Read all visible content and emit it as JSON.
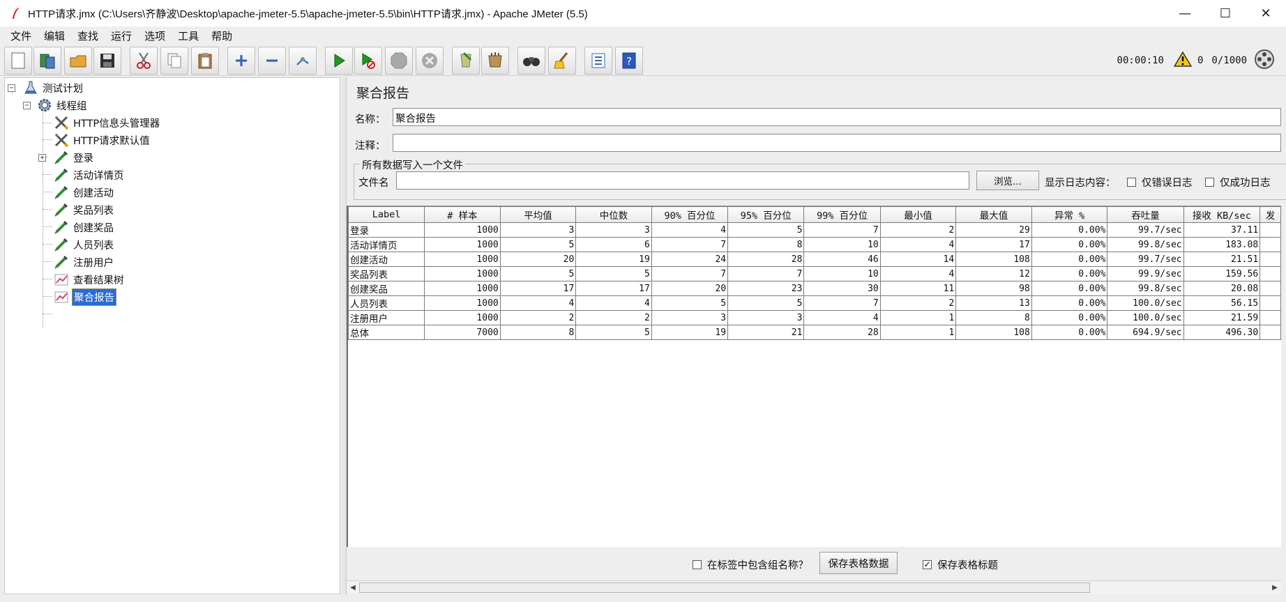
{
  "window": {
    "title": "HTTP请求.jmx (C:\\Users\\齐静波\\Desktop\\apache-jmeter-5.5\\apache-jmeter-5.5\\bin\\HTTP请求.jmx) - Apache JMeter (5.5)",
    "minimize": "—",
    "maximize": "☐",
    "close": "✕"
  },
  "menu": [
    "文件",
    "编辑",
    "查找",
    "运行",
    "选项",
    "工具",
    "帮助"
  ],
  "toolbar": {
    "buttons": [
      "new-icon",
      "templates-icon",
      "open-icon",
      "save-icon",
      "cut-icon",
      "copy-icon",
      "paste-icon",
      "expand-icon",
      "collapse-icon",
      "toggle-icon",
      "start-icon",
      "start-no-pause-icon",
      "stop-icon",
      "shutdown-icon",
      "clear-icon",
      "clear-all-icon",
      "search-icon",
      "reset-search-icon",
      "function-helper-icon",
      "help-icon"
    ],
    "elapsed_time": "00:00:10",
    "warning_count": "0",
    "threads": "0/1000"
  },
  "tree": {
    "items": [
      {
        "label": "测试计划",
        "icon": "test-plan-icon"
      },
      {
        "label": "线程组",
        "icon": "thread-group-icon"
      },
      {
        "label": "HTTP信息头管理器",
        "icon": "config-tools-icon"
      },
      {
        "label": "HTTP请求默认值",
        "icon": "config-tools-icon"
      },
      {
        "label": "登录",
        "icon": "sampler-pipette-icon"
      },
      {
        "label": "活动详情页",
        "icon": "sampler-pipette-icon"
      },
      {
        "label": "创建活动",
        "icon": "sampler-pipette-icon"
      },
      {
        "label": "奖品列表",
        "icon": "sampler-pipette-icon"
      },
      {
        "label": "创建奖品",
        "icon": "sampler-pipette-icon"
      },
      {
        "label": "人员列表",
        "icon": "sampler-pipette-icon"
      },
      {
        "label": "注册用户",
        "icon": "sampler-pipette-icon"
      },
      {
        "label": "查看结果树",
        "icon": "listener-chart-icon"
      },
      {
        "label": "聚合报告",
        "icon": "listener-chart-icon"
      }
    ],
    "selected_label": "聚合报告"
  },
  "report": {
    "title": "聚合报告",
    "name_label": "名称：",
    "name_value": "聚合报告",
    "comment_label": "注释：",
    "comment_value": "",
    "file_group_legend": "所有数据写入一个文件",
    "filename_label": "文件名",
    "filename_value": "",
    "browse_button": "浏览...",
    "log_content_label": "显示日志内容：",
    "errors_only": "仅错误日志",
    "success_only": "仅成功日志"
  },
  "table": {
    "columns": [
      "Label",
      "# 样本",
      "平均值",
      "中位数",
      "90% 百分位",
      "95% 百分位",
      "99% 百分位",
      "最小值",
      "最大值",
      "异常 %",
      "吞吐量",
      "接收 KB/sec",
      "发"
    ],
    "rows": [
      [
        "登录",
        "1000",
        "3",
        "3",
        "4",
        "5",
        "7",
        "2",
        "29",
        "0.00%",
        "99.7/sec",
        "37.11"
      ],
      [
        "活动详情页",
        "1000",
        "5",
        "6",
        "7",
        "8",
        "10",
        "4",
        "17",
        "0.00%",
        "99.8/sec",
        "183.08"
      ],
      [
        "创建活动",
        "1000",
        "20",
        "19",
        "24",
        "28",
        "46",
        "14",
        "108",
        "0.00%",
        "99.7/sec",
        "21.51"
      ],
      [
        "奖品列表",
        "1000",
        "5",
        "5",
        "7",
        "7",
        "10",
        "4",
        "12",
        "0.00%",
        "99.9/sec",
        "159.56"
      ],
      [
        "创建奖品",
        "1000",
        "17",
        "17",
        "20",
        "23",
        "30",
        "11",
        "98",
        "0.00%",
        "99.8/sec",
        "20.08"
      ],
      [
        "人员列表",
        "1000",
        "4",
        "4",
        "5",
        "5",
        "7",
        "2",
        "13",
        "0.00%",
        "100.0/sec",
        "56.15"
      ],
      [
        "注册用户",
        "1000",
        "2",
        "2",
        "3",
        "3",
        "4",
        "1",
        "8",
        "0.00%",
        "100.0/sec",
        "21.59"
      ],
      [
        "总体",
        "7000",
        "8",
        "5",
        "19",
        "21",
        "28",
        "1",
        "108",
        "0.00%",
        "694.9/sec",
        "496.30"
      ]
    ]
  },
  "bottom": {
    "include_group_name": "在标签中包含组名称？",
    "save_table_data": "保存表格数据",
    "save_table_header": "保存表格标题",
    "save_table_header_checked": true
  }
}
